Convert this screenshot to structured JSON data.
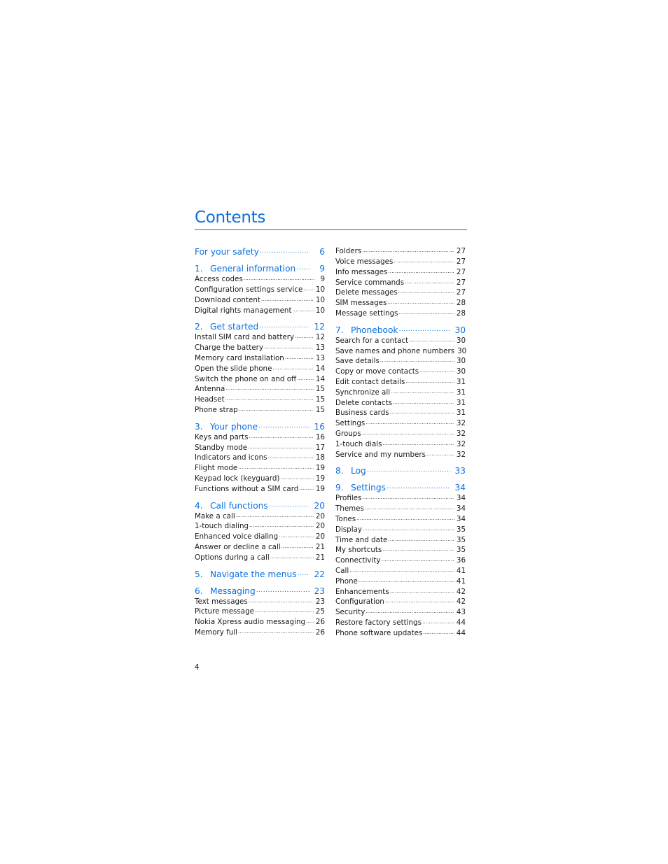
{
  "document": {
    "title": "Contents",
    "accent_color": "#0a6fe0",
    "page_number": "4"
  },
  "toc": {
    "left_column": [
      {
        "type": "chapter",
        "num": "",
        "label": "For your safety",
        "page": "6"
      },
      {
        "type": "chapter",
        "num": "1.",
        "label": "General information",
        "page": "9"
      },
      {
        "type": "item",
        "label": "Access codes",
        "page": "9"
      },
      {
        "type": "item",
        "label": "Configuration settings service",
        "page": "10"
      },
      {
        "type": "item",
        "label": "Download content",
        "page": "10"
      },
      {
        "type": "item",
        "label": "Digital rights management",
        "page": "10"
      },
      {
        "type": "chapter",
        "num": "2.",
        "label": "Get started",
        "page": "12"
      },
      {
        "type": "item",
        "label": "Install SIM card and battery",
        "page": "12"
      },
      {
        "type": "item",
        "label": "Charge the battery",
        "page": "13"
      },
      {
        "type": "item",
        "label": "Memory card installation",
        "page": "13"
      },
      {
        "type": "item",
        "label": "Open the slide phone",
        "page": "14"
      },
      {
        "type": "item",
        "label": "Switch the phone on and off",
        "page": "14"
      },
      {
        "type": "item",
        "label": "Antenna",
        "page": "15"
      },
      {
        "type": "item",
        "label": "Headset",
        "page": "15"
      },
      {
        "type": "item",
        "label": "Phone strap",
        "page": "15"
      },
      {
        "type": "chapter",
        "num": "3.",
        "label": "Your phone",
        "page": "16"
      },
      {
        "type": "item",
        "label": "Keys and parts",
        "page": "16"
      },
      {
        "type": "item",
        "label": "Standby mode",
        "page": "17"
      },
      {
        "type": "item",
        "label": "Indicators and icons",
        "page": "18"
      },
      {
        "type": "item",
        "label": "Flight mode",
        "page": "19"
      },
      {
        "type": "item",
        "label": "Keypad lock (keyguard)",
        "page": "19"
      },
      {
        "type": "item",
        "label": "Functions without a SIM card",
        "page": "19"
      },
      {
        "type": "chapter",
        "num": "4.",
        "label": "Call functions",
        "page": "20"
      },
      {
        "type": "item",
        "label": "Make a call",
        "page": "20"
      },
      {
        "type": "item",
        "label": "1-touch dialing",
        "page": "20"
      },
      {
        "type": "item",
        "label": "Enhanced voice dialing",
        "page": "20"
      },
      {
        "type": "item",
        "label": "Answer or decline a call",
        "page": "21"
      },
      {
        "type": "item",
        "label": "Options during a call",
        "page": "21"
      },
      {
        "type": "chapter",
        "num": "5.",
        "label": "Navigate the menus",
        "page": "22"
      },
      {
        "type": "chapter",
        "num": "6.",
        "label": "Messaging",
        "page": "23"
      },
      {
        "type": "item",
        "label": "Text messages",
        "page": "23"
      },
      {
        "type": "item",
        "label": "Picture message",
        "page": "25"
      },
      {
        "type": "item",
        "label": "Nokia Xpress audio messaging",
        "page": "26"
      },
      {
        "type": "item",
        "label": "Memory full",
        "page": "26"
      }
    ],
    "right_column": [
      {
        "type": "item",
        "label": "Folders",
        "page": "27"
      },
      {
        "type": "item",
        "label": "Voice messages",
        "page": "27"
      },
      {
        "type": "item",
        "label": "Info messages",
        "page": "27"
      },
      {
        "type": "item",
        "label": "Service commands",
        "page": "27"
      },
      {
        "type": "item",
        "label": "Delete messages",
        "page": "27"
      },
      {
        "type": "item",
        "label": "SIM messages",
        "page": "28"
      },
      {
        "type": "item",
        "label": "Message settings",
        "page": "28"
      },
      {
        "type": "chapter",
        "num": "7.",
        "label": "Phonebook",
        "page": "30"
      },
      {
        "type": "item",
        "label": "Search for a contact",
        "page": "30"
      },
      {
        "type": "item",
        "label": "Save names and phone numbers",
        "page": "30"
      },
      {
        "type": "item",
        "label": "Save details",
        "page": "30"
      },
      {
        "type": "item",
        "label": "Copy or move contacts",
        "page": "30"
      },
      {
        "type": "item",
        "label": "Edit contact details",
        "page": "31"
      },
      {
        "type": "item",
        "label": "Synchronize all",
        "page": "31"
      },
      {
        "type": "item",
        "label": "Delete contacts",
        "page": "31"
      },
      {
        "type": "item",
        "label": "Business cards",
        "page": "31"
      },
      {
        "type": "item",
        "label": "Settings",
        "page": "32"
      },
      {
        "type": "item",
        "label": "Groups",
        "page": "32"
      },
      {
        "type": "item",
        "label": "1-touch dials",
        "page": "32"
      },
      {
        "type": "item",
        "label": "Service and my numbers",
        "page": "32"
      },
      {
        "type": "chapter",
        "num": "8.",
        "label": "Log",
        "page": "33"
      },
      {
        "type": "chapter",
        "num": "9.",
        "label": "Settings",
        "page": "34"
      },
      {
        "type": "item",
        "label": "Profiles",
        "page": "34"
      },
      {
        "type": "item",
        "label": "Themes",
        "page": "34"
      },
      {
        "type": "item",
        "label": "Tones",
        "page": "34"
      },
      {
        "type": "item",
        "label": "Display",
        "page": "35"
      },
      {
        "type": "item",
        "label": "Time and date",
        "page": "35"
      },
      {
        "type": "item",
        "label": "My shortcuts",
        "page": "35"
      },
      {
        "type": "item",
        "label": "Connectivity",
        "page": "36"
      },
      {
        "type": "item",
        "label": "Call",
        "page": "41"
      },
      {
        "type": "item",
        "label": "Phone",
        "page": "41"
      },
      {
        "type": "item",
        "label": "Enhancements",
        "page": "42"
      },
      {
        "type": "item",
        "label": "Configuration",
        "page": "42"
      },
      {
        "type": "item",
        "label": "Security",
        "page": "43"
      },
      {
        "type": "item",
        "label": "Restore factory settings",
        "page": "44"
      },
      {
        "type": "item",
        "label": "Phone software updates",
        "page": "44"
      }
    ]
  }
}
